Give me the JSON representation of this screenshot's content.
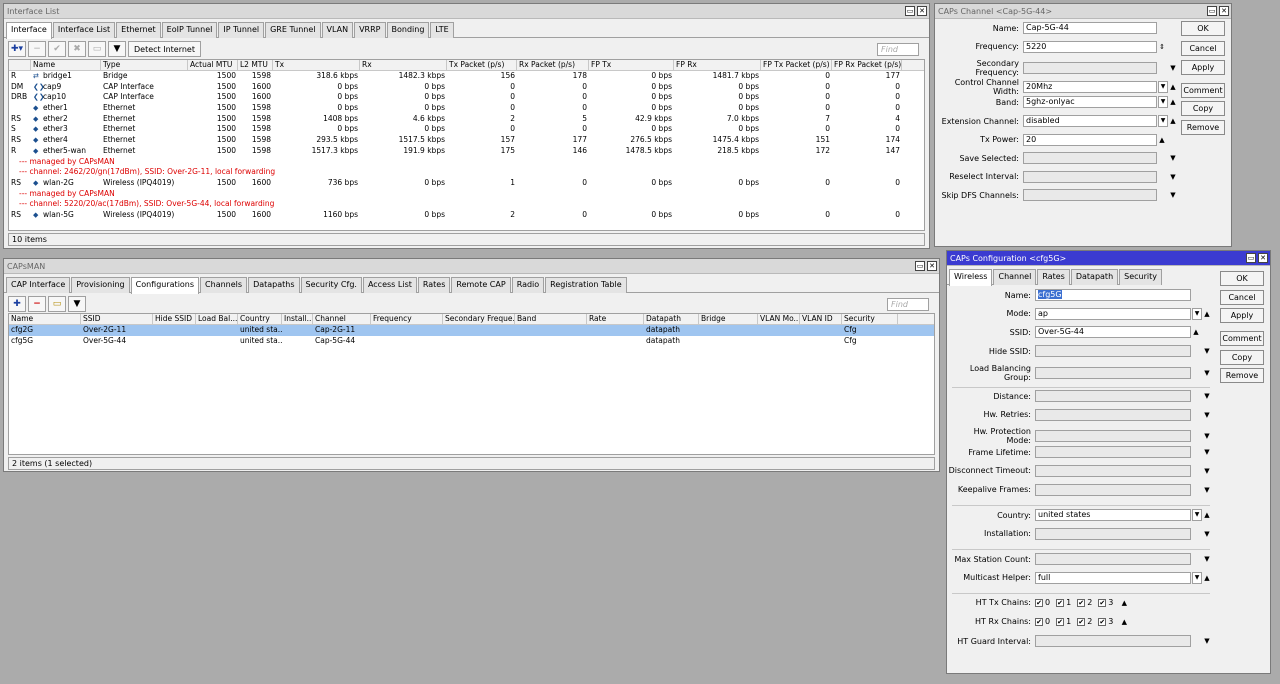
{
  "interface_list": {
    "title": "Interface List",
    "tabs": [
      "Interface",
      "Interface List",
      "Ethernet",
      "EoIP Tunnel",
      "IP Tunnel",
      "GRE Tunnel",
      "VLAN",
      "VRRP",
      "Bonding",
      "LTE"
    ],
    "detect_label": "Detect Internet",
    "find": "Find",
    "columns": [
      "",
      "Name",
      "Type",
      "Actual MTU",
      "L2 MTU",
      "Tx",
      "Rx",
      "Tx Packet (p/s)",
      "Rx Packet (p/s)",
      "FP Tx",
      "FP Rx",
      "FP Tx Packet (p/s)",
      "FP Rx Packet (p/s)"
    ],
    "rows": [
      {
        "flag": "R",
        "icon": "bridge-icon",
        "name": "bridge1",
        "type": "Bridge",
        "amtu": "1500",
        "l2mtu": "1598",
        "tx": "318.6 kbps",
        "rx": "1482.3 kbps",
        "txp": "156",
        "rxp": "178",
        "fptx": "0 bps",
        "fprx": "1481.7 kbps",
        "fptxp": "0",
        "fprxp": "177"
      },
      {
        "flag": "DM",
        "icon": "cap-icon",
        "name": "cap9",
        "type": "CAP Interface",
        "amtu": "1500",
        "l2mtu": "1600",
        "tx": "0 bps",
        "rx": "0 bps",
        "txp": "0",
        "rxp": "0",
        "fptx": "0 bps",
        "fprx": "0 bps",
        "fptxp": "0",
        "fprxp": "0"
      },
      {
        "flag": "DRB",
        "icon": "cap-icon",
        "name": "cap10",
        "type": "CAP Interface",
        "amtu": "1500",
        "l2mtu": "1600",
        "tx": "0 bps",
        "rx": "0 bps",
        "txp": "0",
        "rxp": "0",
        "fptx": "0 bps",
        "fprx": "0 bps",
        "fptxp": "0",
        "fprxp": "0"
      },
      {
        "flag": "",
        "icon": "ethernet-icon",
        "name": "ether1",
        "type": "Ethernet",
        "amtu": "1500",
        "l2mtu": "1598",
        "tx": "0 bps",
        "rx": "0 bps",
        "txp": "0",
        "rxp": "0",
        "fptx": "0 bps",
        "fprx": "0 bps",
        "fptxp": "0",
        "fprxp": "0"
      },
      {
        "flag": "RS",
        "icon": "ethernet-icon",
        "name": "ether2",
        "type": "Ethernet",
        "amtu": "1500",
        "l2mtu": "1598",
        "tx": "1408 bps",
        "rx": "4.6 kbps",
        "txp": "2",
        "rxp": "5",
        "fptx": "42.9 kbps",
        "fprx": "7.0 kbps",
        "fptxp": "7",
        "fprxp": "4"
      },
      {
        "flag": "S",
        "icon": "ethernet-icon",
        "name": "ether3",
        "type": "Ethernet",
        "amtu": "1500",
        "l2mtu": "1598",
        "tx": "0 bps",
        "rx": "0 bps",
        "txp": "0",
        "rxp": "0",
        "fptx": "0 bps",
        "fprx": "0 bps",
        "fptxp": "0",
        "fprxp": "0"
      },
      {
        "flag": "RS",
        "icon": "ethernet-icon",
        "name": "ether4",
        "type": "Ethernet",
        "amtu": "1500",
        "l2mtu": "1598",
        "tx": "293.5 kbps",
        "rx": "1517.5 kbps",
        "txp": "157",
        "rxp": "177",
        "fptx": "276.5 kbps",
        "fprx": "1475.4 kbps",
        "fptxp": "151",
        "fprxp": "174"
      },
      {
        "flag": "R",
        "icon": "ethernet-icon",
        "name": "ether5-wan",
        "type": "Ethernet",
        "amtu": "1500",
        "l2mtu": "1598",
        "tx": "1517.3 kbps",
        "rx": "191.9 kbps",
        "txp": "175",
        "rxp": "146",
        "fptx": "1478.5 kbps",
        "fprx": "218.5 kbps",
        "fptxp": "172",
        "fprxp": "147"
      }
    ],
    "comment1a": "--- managed by CAPsMAN",
    "comment1b": "--- channel: 2462/20/gn(17dBm), SSID: Over-2G-11, local forwarding",
    "wlan2g": {
      "flag": "RS",
      "name": "wlan-2G",
      "type": "Wireless (IPQ4019)",
      "amtu": "1500",
      "l2mtu": "1600",
      "tx": "736 bps",
      "rx": "0 bps",
      "txp": "1",
      "rxp": "0",
      "fptx": "0 bps",
      "fprx": "0 bps",
      "fptxp": "0",
      "fprxp": "0"
    },
    "comment2a": "--- managed by CAPsMAN",
    "comment2b": "--- channel: 5220/20/ac(17dBm), SSID: Over-5G-44, local forwarding",
    "wlan5g": {
      "flag": "RS",
      "name": "wlan-5G",
      "type": "Wireless (IPQ4019)",
      "amtu": "1500",
      "l2mtu": "1600",
      "tx": "1160 bps",
      "rx": "0 bps",
      "txp": "2",
      "rxp": "0",
      "fptx": "0 bps",
      "fprx": "0 bps",
      "fptxp": "0",
      "fprxp": "0"
    },
    "status": "10 items"
  },
  "capsman": {
    "title": "CAPsMAN",
    "tabs": [
      "CAP Interface",
      "Provisioning",
      "Configurations",
      "Channels",
      "Datapaths",
      "Security Cfg.",
      "Access List",
      "Rates",
      "Remote CAP",
      "Radio",
      "Registration Table"
    ],
    "find": "Find",
    "columns": [
      "Name",
      "SSID",
      "Hide SSID",
      "Load Bal...",
      "Country",
      "Install...",
      "Channel",
      "Frequency",
      "Secondary Freque...",
      "Band",
      "Rate",
      "Datapath",
      "Bridge",
      "VLAN Mo...",
      "VLAN ID",
      "Security"
    ],
    "rows": [
      {
        "name": "cfg2G",
        "ssid": "Over-2G-11",
        "country": "united sta...",
        "channel": "Cap-2G-11",
        "datapath": "datapath",
        "security": "Cfg"
      },
      {
        "name": "cfg5G",
        "ssid": "Over-5G-44",
        "country": "united sta...",
        "channel": "Cap-5G-44",
        "datapath": "datapath",
        "security": "Cfg"
      }
    ],
    "status": "2 items (1 selected)"
  },
  "channel_dialog": {
    "title": "CAPs Channel <Cap-5G-44>",
    "fields": [
      {
        "label": "Name:",
        "value": "Cap-5G-44",
        "kind": "text"
      },
      {
        "label": "Frequency:",
        "value": "5220",
        "kind": "spin"
      },
      {
        "label": "Secondary Frequency:",
        "value": "",
        "kind": "dd"
      },
      {
        "label": "Control Channel Width:",
        "value": "20Mhz",
        "kind": "ddv"
      },
      {
        "label": "Band:",
        "value": "5ghz-onlyac",
        "kind": "ddv"
      },
      {
        "label": "Extension Channel:",
        "value": "disabled",
        "kind": "ddv"
      },
      {
        "label": "Tx Power:",
        "value": "20",
        "kind": "up"
      },
      {
        "label": "Save Selected:",
        "value": "",
        "kind": "dd"
      },
      {
        "label": "Reselect Interval:",
        "value": "",
        "kind": "dd"
      },
      {
        "label": "Skip DFS Channels:",
        "value": "",
        "kind": "dd"
      }
    ],
    "buttons": [
      "OK",
      "Cancel",
      "Apply",
      "Comment",
      "Copy",
      "Remove"
    ]
  },
  "config_dialog": {
    "title": "CAPs Configuration <cfg5G>",
    "tabs": [
      "Wireless",
      "Channel",
      "Rates",
      "Datapath",
      "Security"
    ],
    "fields": [
      {
        "label": "Name:",
        "value": "cfg5G",
        "kind": "text"
      },
      {
        "label": "Mode:",
        "value": "ap",
        "kind": "ddv"
      },
      {
        "label": "SSID:",
        "value": "Over-5G-44",
        "kind": "up"
      },
      {
        "label": "Hide SSID:",
        "value": "",
        "kind": "dd"
      },
      {
        "label": "Load Balancing Group:",
        "value": "",
        "kind": "dd"
      }
    ],
    "fields2": [
      {
        "label": "Distance:",
        "value": "",
        "kind": "dd"
      },
      {
        "label": "Hw. Retries:",
        "value": "",
        "kind": "dd"
      },
      {
        "label": "Hw. Protection Mode:",
        "value": "",
        "kind": "dd"
      },
      {
        "label": "Frame Lifetime:",
        "value": "",
        "kind": "dd"
      },
      {
        "label": "Disconnect Timeout:",
        "value": "",
        "kind": "dd"
      },
      {
        "label": "Keepalive Frames:",
        "value": "",
        "kind": "dd"
      }
    ],
    "fields3": [
      {
        "label": "Country:",
        "value": "united states",
        "kind": "ddv"
      },
      {
        "label": "Installation:",
        "value": "",
        "kind": "dd"
      }
    ],
    "fields4": [
      {
        "label": "Max Station Count:",
        "value": "",
        "kind": "dd"
      },
      {
        "label": "Multicast Helper:",
        "value": "full",
        "kind": "ddv"
      }
    ],
    "tx_chains_label": "HT Tx Chains:",
    "rx_chains_label": "HT Rx Chains:",
    "chains": [
      "0",
      "1",
      "2",
      "3"
    ],
    "guard_label": "HT Guard Interval:",
    "buttons": [
      "OK",
      "Cancel",
      "Apply",
      "Comment",
      "Copy",
      "Remove"
    ]
  }
}
